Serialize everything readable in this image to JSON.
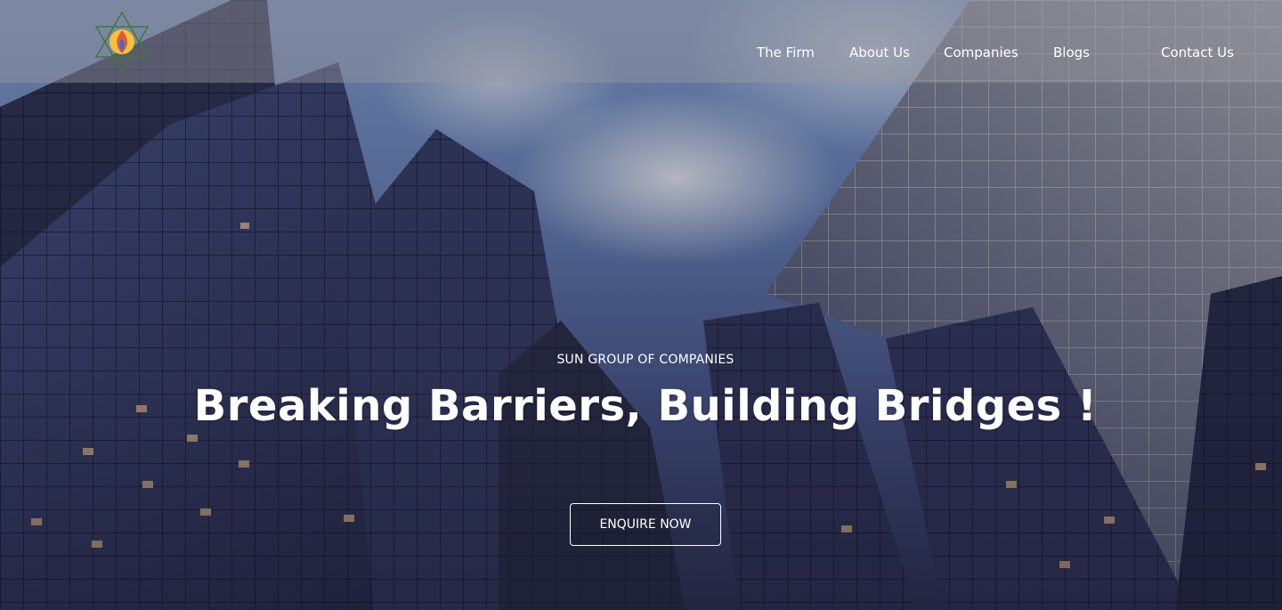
{
  "nav": {
    "items": [
      "The Firm",
      "About Us",
      "Companies",
      "Blogs",
      "Contact Us"
    ]
  },
  "hero": {
    "eyebrow": "SUN GROUP OF COMPANIES",
    "headline": "Breaking Barriers, Building Bridges !",
    "cta_label": "ENQUIRE NOW"
  },
  "colors": {
    "text": "#ffffff",
    "logo_star": "#3d7a3a",
    "logo_flame": "#f5a623"
  }
}
